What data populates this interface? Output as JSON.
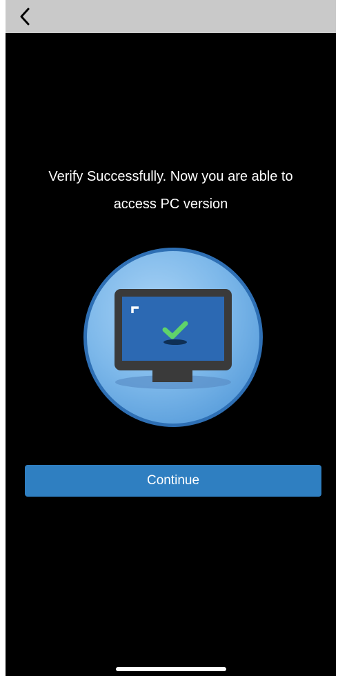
{
  "nav": {
    "back_icon": "chevron-left-icon"
  },
  "message": {
    "line1": "Verify Successfully. Now you are able to",
    "line2": "access PC version"
  },
  "illustration": {
    "icon": "monitor-checkmark-icon",
    "colors": {
      "circle": "#7db8ea",
      "circle_border": "#2e6fb4",
      "screen": "#2c69b3",
      "bezel": "#3a3a3a",
      "check": "#5fd36a"
    }
  },
  "actions": {
    "continue_label": "Continue",
    "continue_color": "#2f7fc1"
  }
}
